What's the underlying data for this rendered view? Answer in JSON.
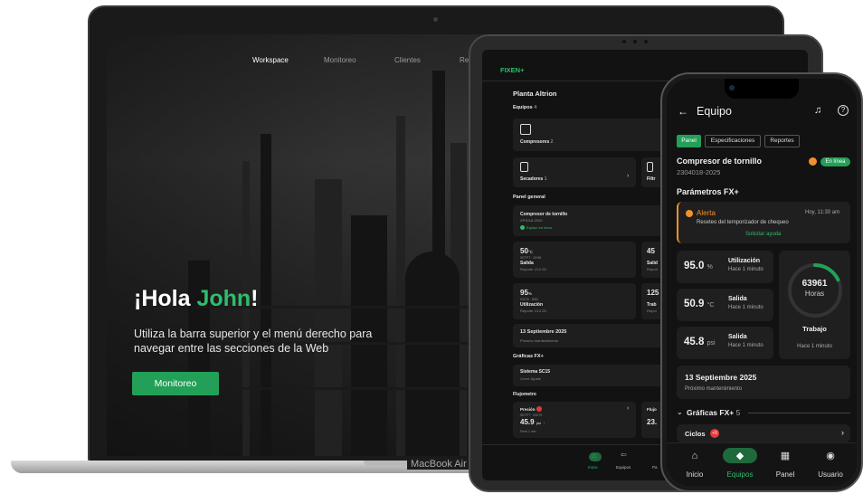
{
  "laptop": {
    "nav": [
      "Workspace",
      "Monitoreo",
      "Clientes",
      "Rep"
    ],
    "greeting_prefix": "¡Hola ",
    "greeting_name": "John",
    "greeting_suffix": "!",
    "subtitle": "Utiliza la barra superior y el menú derecho para navegar entre las secciones de la Web",
    "cta_label": "Monitoreo",
    "model": "MacBook Air"
  },
  "tablet": {
    "brand": "FIXEN+",
    "plant": "Planta Altrion",
    "equipos_label": "Equipos",
    "equipos_count": "4",
    "compresores_label": "Compresores",
    "compresores_count": "2",
    "secadores_label": "Secadores",
    "secadores_count": "1",
    "filtros_label": "Filtr",
    "panel_general": "Panel general",
    "equipo_name": "Compresor de tornillo",
    "equipo_serial": "XP4018-2025",
    "equipo_status": "Equipo en línea",
    "m1_value": "50",
    "m1_unit": "°C",
    "m1_code": "SETPT · 02/98",
    "m1_label": "Salida",
    "m1_date": "Reporte 13.2.25",
    "m2_value": "45",
    "m2_label": "Salid",
    "m2_date": "Report",
    "m3_value": "95",
    "m3_unit": "%",
    "m3_code": "0/3/76 · 8/50",
    "m3_label": "Utilización",
    "m3_date": "Reporte 13.2.25",
    "m4_value": "125",
    "m4_label": "Trab",
    "m4_date": "Repor",
    "date": "13 Septiembre 2025",
    "date_sub": "Próximo mantenimiento",
    "graficas": "Gráficas FX+",
    "sistema": "Sistema SC15",
    "sistema_sub": "Cront. Ajuste",
    "flujometro": "Flujometro",
    "presion_label": "Presión",
    "presion_code": "SETPT · 0/3/75",
    "presion_value": "45.9",
    "presion_unit": "psi",
    "presion_sub": "Presi 1 min",
    "flujo_label": "Flujo",
    "flujo_value": "23.",
    "nav": [
      "Inicio",
      "Equipos",
      "Pa"
    ]
  },
  "phone": {
    "title": "Equipo",
    "tabs": [
      "Panel",
      "Especificaciones",
      "Reportes"
    ],
    "equipment_name": "Compresor de tornillo",
    "serial": "2304018-2025",
    "status": "En línea",
    "section_params": "Parámetros FX+",
    "alert_title": "Alerta",
    "alert_time": "Hoy, 11:30 am",
    "alert_msg": "Reseteo del temporizador de chequeo",
    "alert_action": "Solicitar ayuda",
    "util_value": "95.0",
    "util_unit": "%",
    "util_label": "Utilización",
    "util_sub": "Hace 1 minuto",
    "salida1_value": "50.9",
    "salida1_unit": "°C",
    "salida1_label": "Salida",
    "salida1_sub": "Hace 1 minuto",
    "salida2_value": "45.8",
    "salida2_unit": "psi",
    "salida2_label": "Salida",
    "salida2_sub": "Hace 1 minuto",
    "hours_value": "63961",
    "hours_unit": "Horas",
    "hours_progress": 0.18,
    "trabajo_label": "Trabajo",
    "trabajo_sub": "Hace 1 minuto",
    "date": "13 Septiembre 2025",
    "date_sub": "Próximo mantenimiento",
    "graficas_label": "Gráficas FX+",
    "graficas_count": "5",
    "ciclos_label": "Ciclos",
    "ciclos_badge": "+9",
    "nav": [
      "Inicio",
      "Equipos",
      "Panel",
      "Usuario"
    ],
    "accent": "#23a058",
    "alert_color": "#f0922d"
  }
}
